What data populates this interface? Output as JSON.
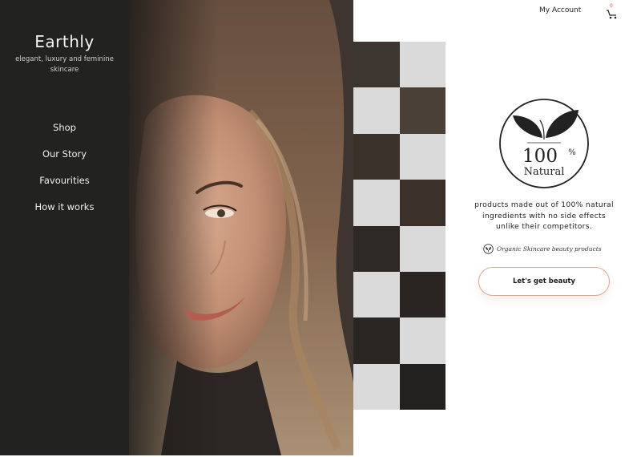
{
  "brand": {
    "name": "Earthly",
    "tagline": "elegant, luxury and feminine skincare"
  },
  "nav": {
    "items": [
      {
        "label": "Shop"
      },
      {
        "label": "Our Story"
      },
      {
        "label": "Favourities"
      },
      {
        "label": "How it works"
      }
    ]
  },
  "header": {
    "account_label": "My Account",
    "cart_count": "0"
  },
  "hero": {
    "seal": {
      "percent": "100",
      "percent_sign": "%",
      "label": "Natural"
    },
    "description": "products made out of 100% natural ingredients with no side effects unlike their competitors.",
    "organic_label": "Organic Skincare beauty products",
    "cta_label": "Let's get beauty"
  },
  "colors": {
    "sidebar_bg": "#222221",
    "checker_light": "#dadada",
    "cta_border": "#d9a892",
    "cart_badge": "#d0502a"
  }
}
